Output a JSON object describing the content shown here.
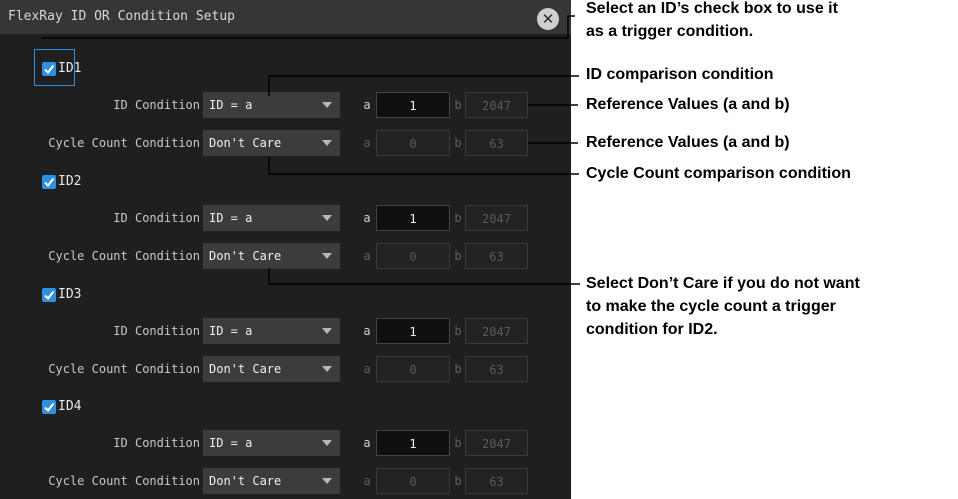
{
  "dialog": {
    "title": "FlexRay ID OR Condition Setup",
    "close_glyph": "✕"
  },
  "labels": {
    "id_condition": "ID Condition",
    "cycle_condition": "Cycle Count Condition",
    "var_a": "a",
    "var_b": "b"
  },
  "sections": [
    {
      "checkbox_label": "ID1",
      "checked": true,
      "focused": true,
      "id_condition_value": "ID = a",
      "id_a": "1",
      "id_b": "2047",
      "cycle_condition_value": "Don't Care",
      "cycle_a": "0",
      "cycle_b": "63"
    },
    {
      "checkbox_label": "ID2",
      "checked": true,
      "focused": false,
      "id_condition_value": "ID = a",
      "id_a": "1",
      "id_b": "2047",
      "cycle_condition_value": "Don't Care",
      "cycle_a": "0",
      "cycle_b": "63"
    },
    {
      "checkbox_label": "ID3",
      "checked": true,
      "focused": false,
      "id_condition_value": "ID = a",
      "id_a": "1",
      "id_b": "2047",
      "cycle_condition_value": "Don't Care",
      "cycle_a": "0",
      "cycle_b": "63"
    },
    {
      "checkbox_label": "ID4",
      "checked": true,
      "focused": false,
      "id_condition_value": "ID = a",
      "id_a": "1",
      "id_b": "2047",
      "cycle_condition_value": "Don't Care",
      "cycle_a": "0",
      "cycle_b": "63"
    }
  ],
  "callouts": {
    "checkbox_line1": "Select an ID’s check box to use it",
    "checkbox_line2": "as a trigger condition.",
    "id_comparison": "ID comparison condition",
    "ref_values_id": "Reference Values (a and b)",
    "ref_values_cycle": "Reference Values (a and b)",
    "cycle_comparison": "Cycle Count comparison condition",
    "dont_care_line1": "Select Don’t Care if you do not want",
    "dont_care_line2": "to make the cycle count a trigger",
    "dont_care_line3": "condition for ID2."
  },
  "colors": {
    "dialog_bg": "#1f1f1f",
    "titlebar_bg": "#363636",
    "checkbox_accent": "#2f8fe0",
    "select_bg": "#3c3c3c",
    "annotation_text": "#000000"
  },
  "icons": {
    "close": "close-circle-icon",
    "checkbox": "checkmark-icon",
    "dropdown": "chevron-down-icon"
  }
}
